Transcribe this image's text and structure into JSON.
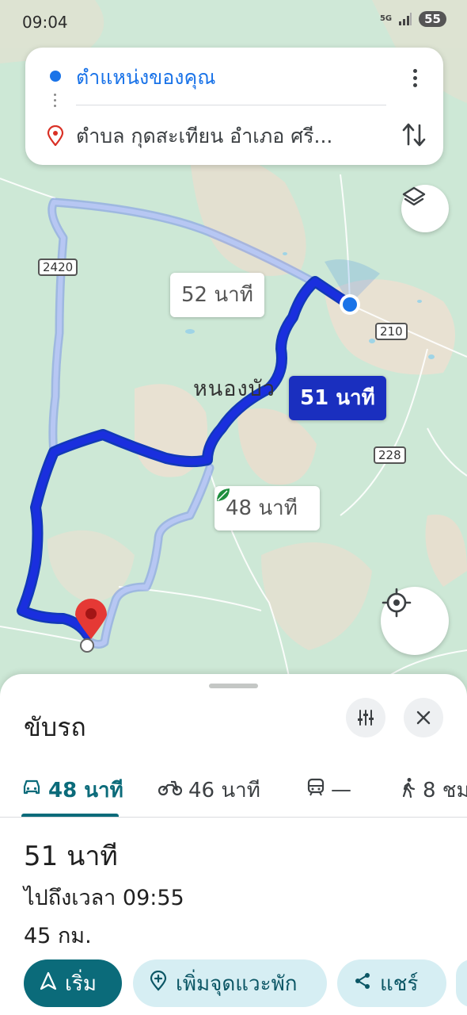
{
  "status_bar": {
    "time": "09:04",
    "network": "5G",
    "battery": "55"
  },
  "search": {
    "origin": "ตำแหน่งของคุณ",
    "destination": "ตำบล กุดสะเทียน อำเภอ ศรี..."
  },
  "map": {
    "place_label": "หนองบัว",
    "road_badges": [
      "2420",
      "210",
      "228"
    ],
    "route_labels": {
      "alt1": "52 นาที",
      "selected": "51 นาที",
      "alt2": "48 นาที"
    },
    "route_color_selected": "#1a2fde",
    "route_color_alt": "#a9bdf0"
  },
  "sheet": {
    "title": "ขับรถ",
    "tabs": [
      {
        "icon": "car-icon",
        "label": "48 นาที"
      },
      {
        "icon": "motorcycle-icon",
        "label": "46 นาที"
      },
      {
        "icon": "transit-icon",
        "label": "—"
      },
      {
        "icon": "walk-icon",
        "label": "8 ชม"
      }
    ],
    "route_time": "51 นาที",
    "arrival": "ไปถึงเวลา 09:55",
    "distance": "45 กม.",
    "actions": {
      "start": "เริ่ม",
      "add_stop": "เพิ่มจุดแวะพัก",
      "share": "แชร์"
    },
    "accent_color": "#0b6b7a"
  }
}
